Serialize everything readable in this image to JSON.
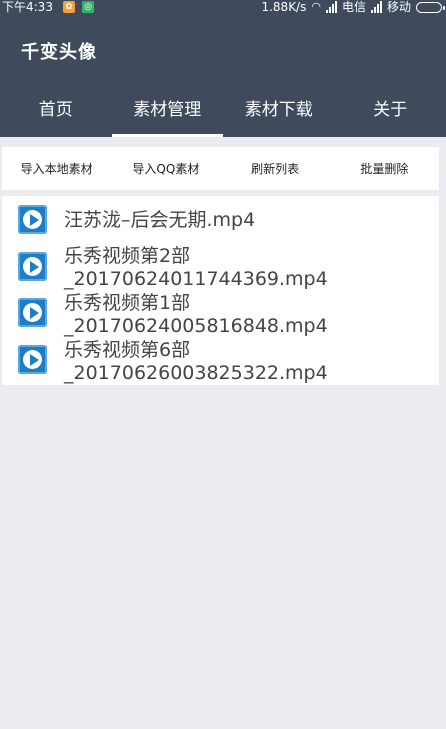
{
  "status_bar": {
    "time": "下午4:33",
    "speed": "1.88K/s",
    "carrier1": "电信",
    "carrier2": "移动"
  },
  "app": {
    "title": "千变头像"
  },
  "tabs": [
    {
      "label": "首页",
      "active": false
    },
    {
      "label": "素材管理",
      "active": true
    },
    {
      "label": "素材下载",
      "active": false
    },
    {
      "label": "关于",
      "active": false
    }
  ],
  "actions": {
    "import_local": "导入本地素材",
    "import_qq": "导入QQ素材",
    "refresh": "刷新列表",
    "batch_delete": "批量删除"
  },
  "files": [
    {
      "line1": "汪苏泷–后会无期.mp4",
      "line2": ""
    },
    {
      "line1": "乐秀视频第2部",
      "line2": "_20170624011744369.mp4"
    },
    {
      "line1": "乐秀视频第1部",
      "line2": "_20170624005816848.mp4"
    },
    {
      "line1": "乐秀视频第6部",
      "line2": "_20170626003825322.mp4"
    }
  ],
  "colors": {
    "app_bar": "#3f4b5c",
    "background": "#ececf0",
    "video_icon": "#1d7dc6"
  }
}
